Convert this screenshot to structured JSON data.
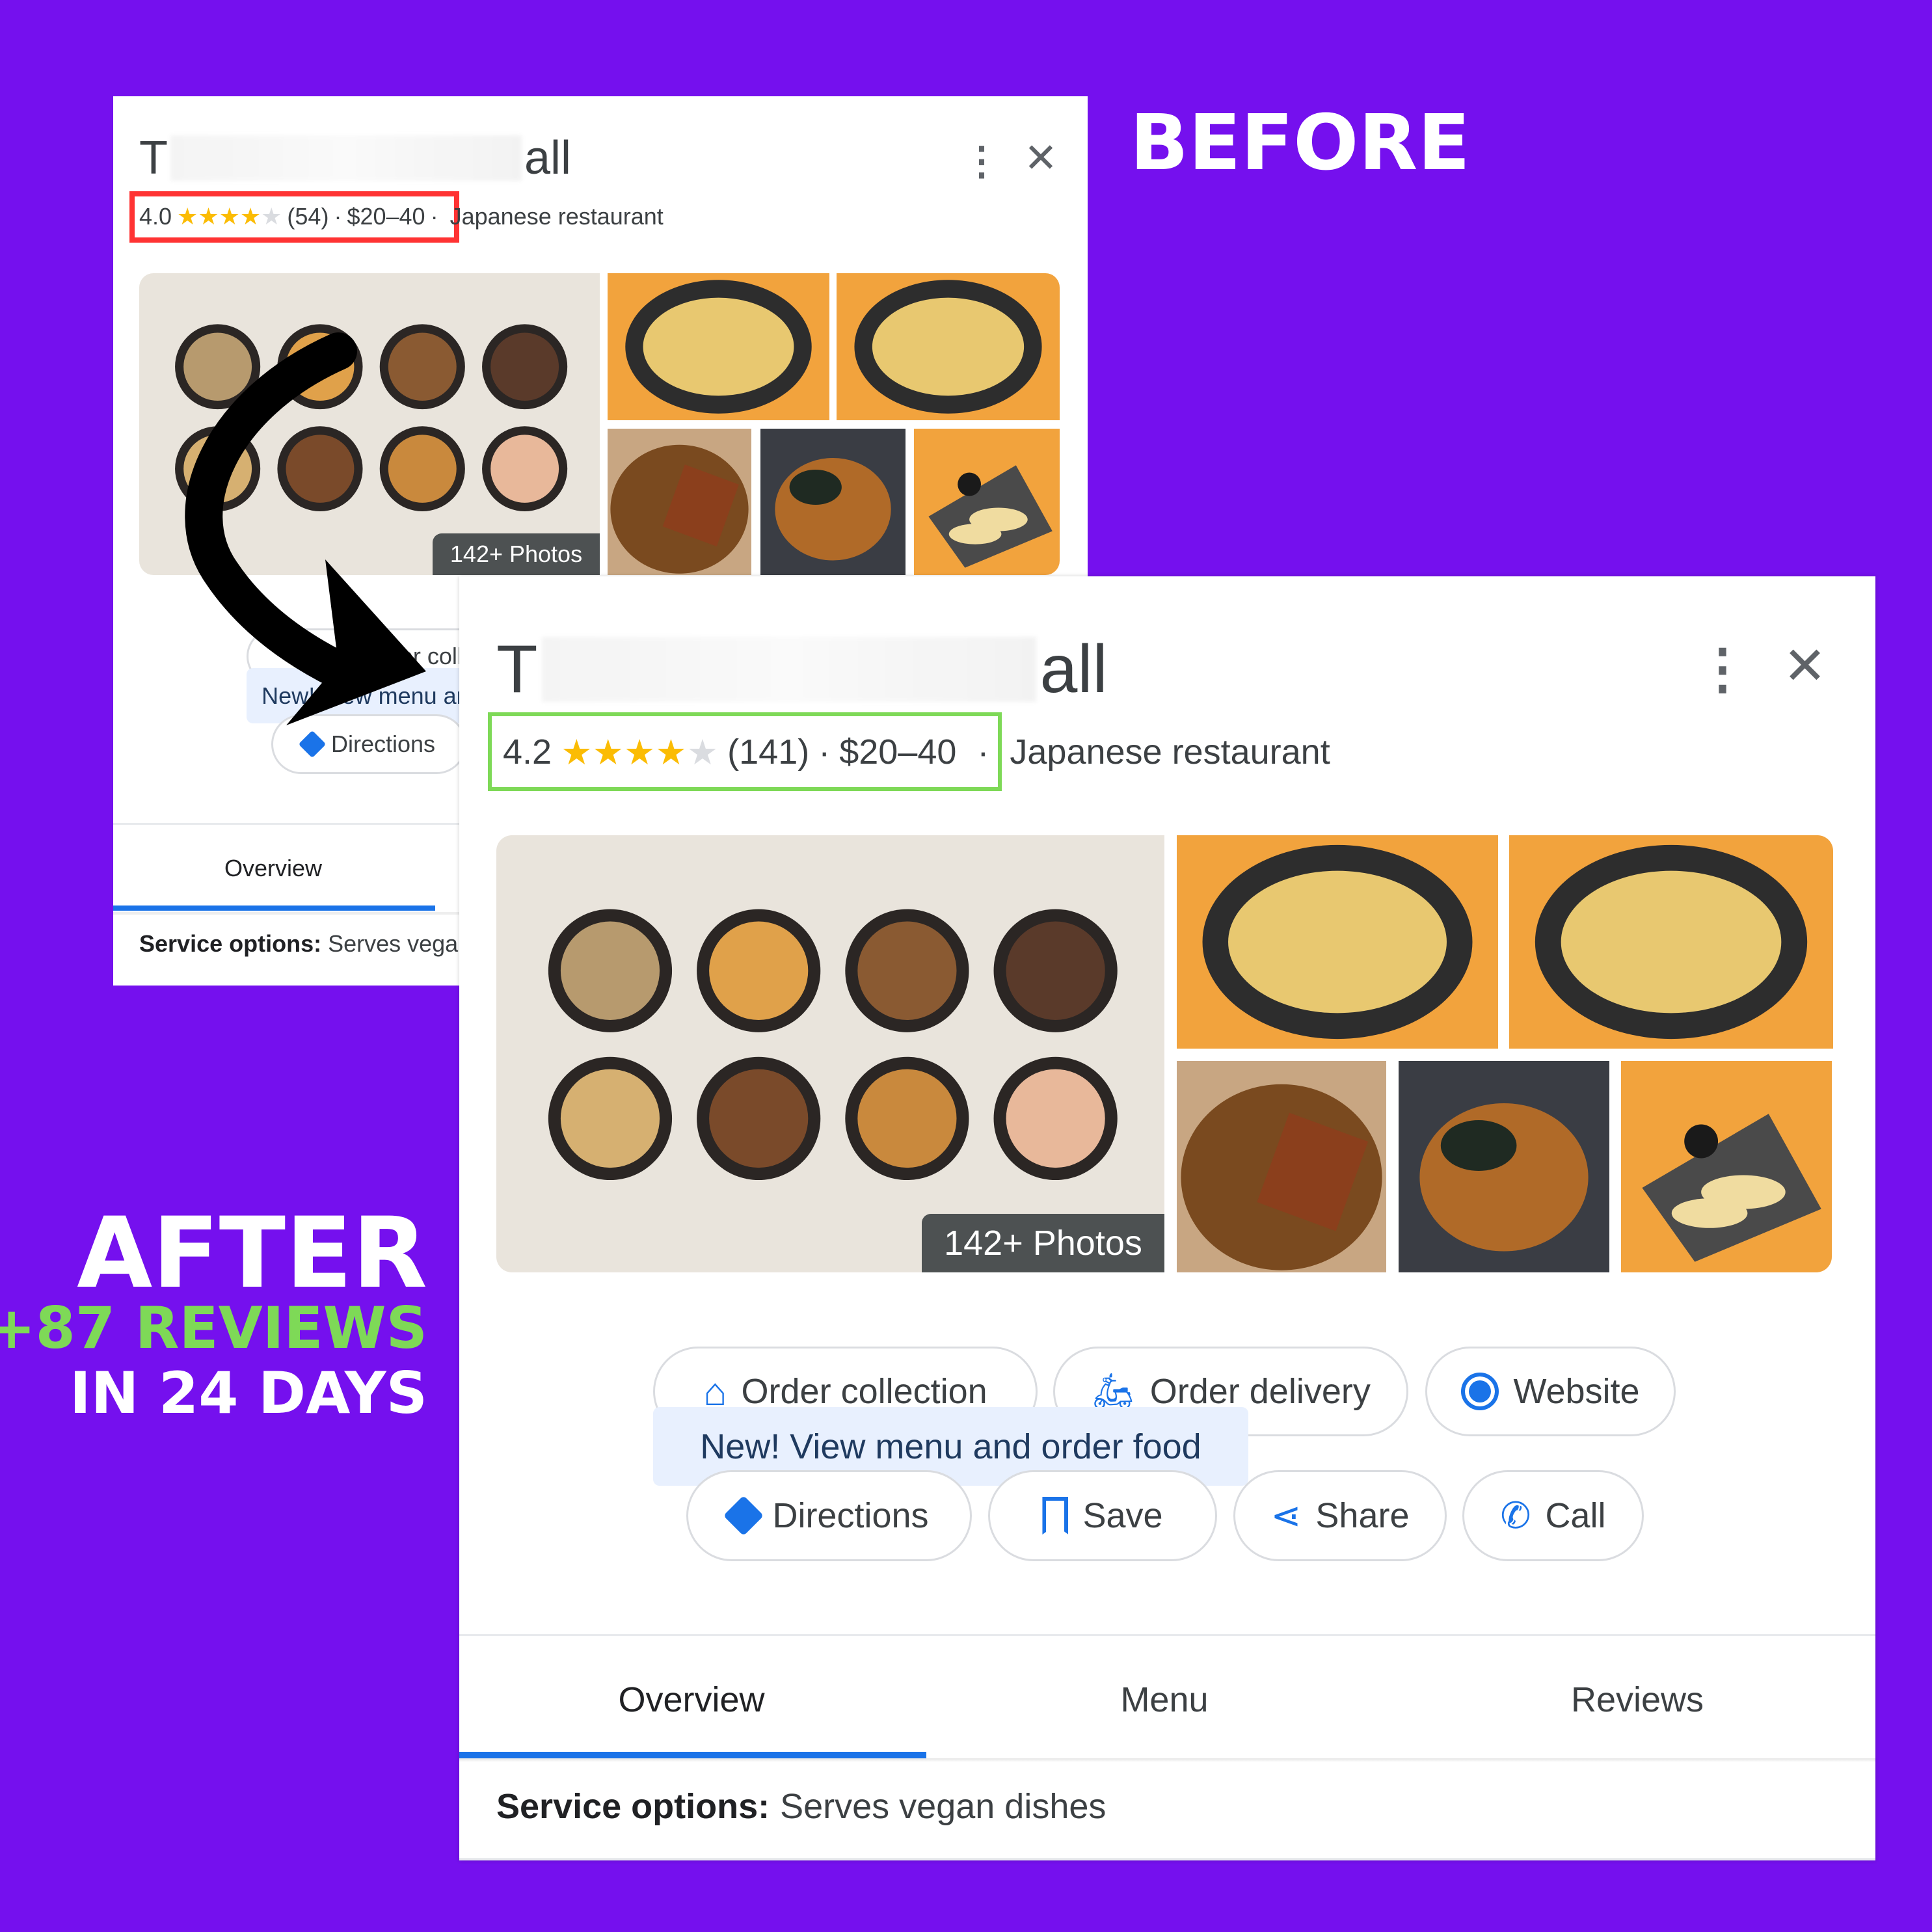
{
  "labels": {
    "before": "BEFORE",
    "after": "AFTER",
    "reviews_gain": "+87 REVIEWS",
    "period": "IN 24 DAYS"
  },
  "colors": {
    "background": "#7510ee",
    "before_highlight": "#ff3333",
    "after_highlight": "#7ed957",
    "accent": "#1a73e8",
    "star": "#fbbc04"
  },
  "before_card": {
    "title_start": "T",
    "title_end": "all",
    "rating": "4.0",
    "stars_filled": 4,
    "stars_total": 5,
    "review_count": "(54)",
    "price": "$20–40",
    "separator": "·",
    "category": "Japanese restaurant",
    "photos_badge": "142+ Photos",
    "order_collection": "Order collection",
    "new_menu_banner": "New! View menu and order food",
    "directions": "Directions",
    "tab_overview": "Overview",
    "service_label": "Service options:",
    "service_value": "Serves vegan dishes"
  },
  "after_card": {
    "title_start": "T",
    "title_end": "all",
    "rating": "4.2",
    "stars_filled": 4,
    "stars_total": 5,
    "review_count": "(141)",
    "price": "$20–40",
    "separator": "·",
    "category": "Japanese restaurant",
    "photos_badge": "142+ Photos",
    "buttons": {
      "order_collection": "Order collection",
      "order_delivery": "Order delivery",
      "website": "Website",
      "directions": "Directions",
      "save": "Save",
      "share": "Share",
      "call": "Call"
    },
    "new_menu_banner": "New! View menu and order food",
    "tabs": [
      "Overview",
      "Menu",
      "Reviews"
    ],
    "active_tab": "Overview",
    "service_label": "Service options:",
    "service_value": "Serves vegan dishes"
  }
}
